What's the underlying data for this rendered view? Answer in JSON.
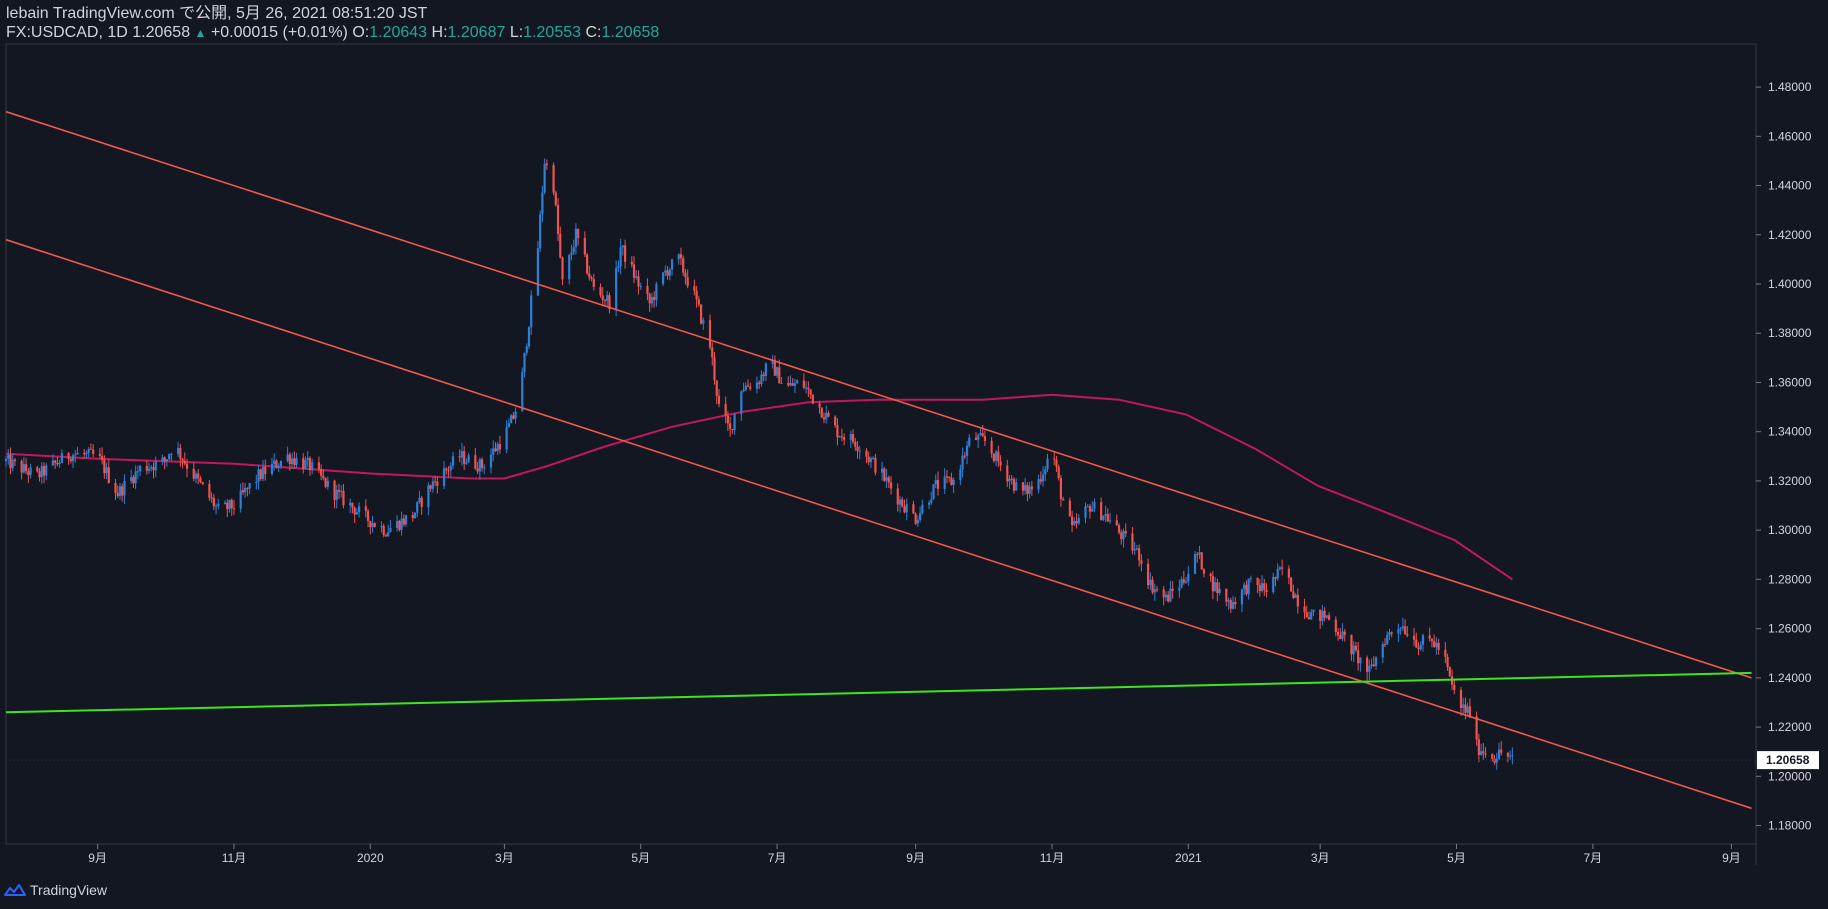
{
  "header": {
    "publish_line": "lebain TradingView.com で公開, 5月 26, 2021 08:51:20 JST",
    "symbol": "FX:USDCAD, 1D",
    "last": "1.20658",
    "change_arrow": "▲",
    "change": "+0.00015 (+0.01%)",
    "o_label": "O:",
    "o_value": "1.20643",
    "h_label": "H:",
    "h_value": "1.20687",
    "l_label": "L:",
    "l_value": "1.20553",
    "c_label": "C:",
    "c_value": "1.20658"
  },
  "footer": {
    "brand": "TradingView",
    "logo_icon": "tradingview-logo-icon"
  },
  "colors": {
    "background": "#131722",
    "bull": "#2e7fd6",
    "bear": "#ef5350",
    "trendline": "#f2594b",
    "support": "#3ee41f",
    "ma": "#c2185b",
    "axis_text": "#d1d4dc"
  },
  "chart_data": {
    "type": "candlestick",
    "symbol": "FX:USDCAD",
    "interval": "1D",
    "y_axis": {
      "ylim": [
        1.1725,
        1.4975
      ],
      "ticks": [
        1.18,
        1.2,
        1.22,
        1.24,
        1.26,
        1.28,
        1.3,
        1.32,
        1.34,
        1.36,
        1.38,
        1.4,
        1.42,
        1.44,
        1.46,
        1.48
      ],
      "tick_labels": [
        "1.18000",
        "1.20000",
        "1.22000",
        "1.24000",
        "1.26000",
        "1.28000",
        "1.30000",
        "1.32000",
        "1.34000",
        "1.36000",
        "1.38000",
        "1.40000",
        "1.42000",
        "1.44000",
        "1.46000",
        "1.48000"
      ],
      "last_price": 1.20658,
      "last_price_label": "1.20658"
    },
    "x_axis": {
      "range": [
        "2019-07-22",
        "2021-09-12"
      ],
      "ticks": [
        {
          "date": "2019-09-01",
          "label": "9月"
        },
        {
          "date": "2019-11-01",
          "label": "11月"
        },
        {
          "date": "2020-01-01",
          "label": "2020"
        },
        {
          "date": "2020-03-01",
          "label": "3月"
        },
        {
          "date": "2020-05-01",
          "label": "5月"
        },
        {
          "date": "2020-07-01",
          "label": "7月"
        },
        {
          "date": "2020-09-01",
          "label": "9月"
        },
        {
          "date": "2020-11-01",
          "label": "11月"
        },
        {
          "date": "2021-01-01",
          "label": "2021"
        },
        {
          "date": "2021-03-01",
          "label": "3月"
        },
        {
          "date": "2021-05-01",
          "label": "5月"
        },
        {
          "date": "2021-07-01",
          "label": "7月"
        },
        {
          "date": "2021-09-01",
          "label": "9月"
        }
      ]
    },
    "price_path": [
      [
        "2019-07-22",
        1.328
      ],
      [
        "2019-08-05",
        1.322
      ],
      [
        "2019-08-20",
        1.331
      ],
      [
        "2019-09-01",
        1.33
      ],
      [
        "2019-09-10",
        1.315
      ],
      [
        "2019-09-20",
        1.325
      ],
      [
        "2019-10-01",
        1.328
      ],
      [
        "2019-10-05",
        1.335
      ],
      [
        "2019-10-12",
        1.325
      ],
      [
        "2019-10-25",
        1.308
      ],
      [
        "2019-11-01",
        1.31
      ],
      [
        "2019-11-12",
        1.322
      ],
      [
        "2019-11-25",
        1.33
      ],
      [
        "2019-12-05",
        1.326
      ],
      [
        "2019-12-15",
        1.316
      ],
      [
        "2019-12-30",
        1.305
      ],
      [
        "2020-01-08",
        1.3
      ],
      [
        "2020-01-20",
        1.306
      ],
      [
        "2020-01-28",
        1.318
      ],
      [
        "2020-02-10",
        1.33
      ],
      [
        "2020-02-20",
        1.326
      ],
      [
        "2020-03-01",
        1.338
      ],
      [
        "2020-03-05",
        1.346
      ],
      [
        "2020-03-08",
        1.355
      ],
      [
        "2020-03-12",
        1.385
      ],
      [
        "2020-03-16",
        1.415
      ],
      [
        "2020-03-19",
        1.45
      ],
      [
        "2020-03-23",
        1.44
      ],
      [
        "2020-03-27",
        1.4
      ],
      [
        "2020-04-02",
        1.42
      ],
      [
        "2020-04-10",
        1.398
      ],
      [
        "2020-04-18",
        1.392
      ],
      [
        "2020-04-22",
        1.415
      ],
      [
        "2020-04-30",
        1.4
      ],
      [
        "2020-05-05",
        1.392
      ],
      [
        "2020-05-12",
        1.405
      ],
      [
        "2020-05-18",
        1.41
      ],
      [
        "2020-05-25",
        1.395
      ],
      [
        "2020-06-01",
        1.375
      ],
      [
        "2020-06-05",
        1.35
      ],
      [
        "2020-06-10",
        1.34
      ],
      [
        "2020-06-15",
        1.358
      ],
      [
        "2020-06-22",
        1.36
      ],
      [
        "2020-06-28",
        1.368
      ],
      [
        "2020-07-05",
        1.358
      ],
      [
        "2020-07-12",
        1.36
      ],
      [
        "2020-07-20",
        1.35
      ],
      [
        "2020-07-28",
        1.34
      ],
      [
        "2020-08-05",
        1.336
      ],
      [
        "2020-08-15",
        1.325
      ],
      [
        "2020-08-25",
        1.312
      ],
      [
        "2020-09-01",
        1.305
      ],
      [
        "2020-09-10",
        1.318
      ],
      [
        "2020-09-18",
        1.32
      ],
      [
        "2020-09-26",
        1.338
      ],
      [
        "2020-10-02",
        1.336
      ],
      [
        "2020-10-10",
        1.325
      ],
      [
        "2020-10-18",
        1.315
      ],
      [
        "2020-10-25",
        1.318
      ],
      [
        "2020-11-01",
        1.333
      ],
      [
        "2020-11-05",
        1.315
      ],
      [
        "2020-11-10",
        1.3
      ],
      [
        "2020-11-18",
        1.31
      ],
      [
        "2020-11-25",
        1.306
      ],
      [
        "2020-12-02",
        1.298
      ],
      [
        "2020-12-10",
        1.29
      ],
      [
        "2020-12-15",
        1.278
      ],
      [
        "2020-12-22",
        1.272
      ],
      [
        "2020-12-30",
        1.28
      ],
      [
        "2021-01-05",
        1.29
      ],
      [
        "2021-01-12",
        1.278
      ],
      [
        "2021-01-20",
        1.27
      ],
      [
        "2021-01-28",
        1.278
      ],
      [
        "2021-02-05",
        1.276
      ],
      [
        "2021-02-12",
        1.284
      ],
      [
        "2021-02-20",
        1.27
      ],
      [
        "2021-02-26",
        1.265
      ],
      [
        "2021-03-04",
        1.265
      ],
      [
        "2021-03-10",
        1.258
      ],
      [
        "2021-03-18",
        1.248
      ],
      [
        "2021-03-23",
        1.242
      ],
      [
        "2021-03-30",
        1.256
      ],
      [
        "2021-04-06",
        1.262
      ],
      [
        "2021-04-14",
        1.254
      ],
      [
        "2021-04-20",
        1.255
      ],
      [
        "2021-04-25",
        1.25
      ],
      [
        "2021-04-29",
        1.236
      ],
      [
        "2021-05-03",
        1.228
      ],
      [
        "2021-05-07",
        1.226
      ],
      [
        "2021-05-10",
        1.212
      ],
      [
        "2021-05-14",
        1.21
      ],
      [
        "2021-05-18",
        1.208
      ],
      [
        "2021-05-22",
        1.21
      ],
      [
        "2021-05-26",
        1.2066
      ]
    ],
    "moving_average": [
      [
        "2019-07-22",
        1.331
      ],
      [
        "2019-09-01",
        1.329
      ],
      [
        "2019-11-01",
        1.327
      ],
      [
        "2020-01-01",
        1.323
      ],
      [
        "2020-02-15",
        1.321
      ],
      [
        "2020-03-01",
        1.321
      ],
      [
        "2020-03-20",
        1.326
      ],
      [
        "2020-04-15",
        1.334
      ],
      [
        "2020-05-15",
        1.342
      ],
      [
        "2020-06-15",
        1.348
      ],
      [
        "2020-07-15",
        1.352
      ],
      [
        "2020-08-15",
        1.353
      ],
      [
        "2020-10-01",
        1.353
      ],
      [
        "2020-11-01",
        1.355
      ],
      [
        "2020-12-01",
        1.353
      ],
      [
        "2020-12-31",
        1.347
      ],
      [
        "2021-01-31",
        1.333
      ],
      [
        "2021-02-28",
        1.318
      ],
      [
        "2021-03-31",
        1.307
      ],
      [
        "2021-04-30",
        1.296
      ],
      [
        "2021-05-26",
        1.28
      ]
    ],
    "trendlines": [
      {
        "kind": "channel-upper",
        "points": [
          [
            "2019-07-22",
            1.47
          ],
          [
            "2021-09-10",
            1.24
          ]
        ]
      },
      {
        "kind": "channel-lower",
        "points": [
          [
            "2019-07-22",
            1.418
          ],
          [
            "2021-09-10",
            1.187
          ]
        ]
      },
      {
        "kind": "support",
        "points": [
          [
            "2019-07-22",
            1.226
          ],
          [
            "2021-09-10",
            1.242
          ]
        ]
      }
    ]
  }
}
